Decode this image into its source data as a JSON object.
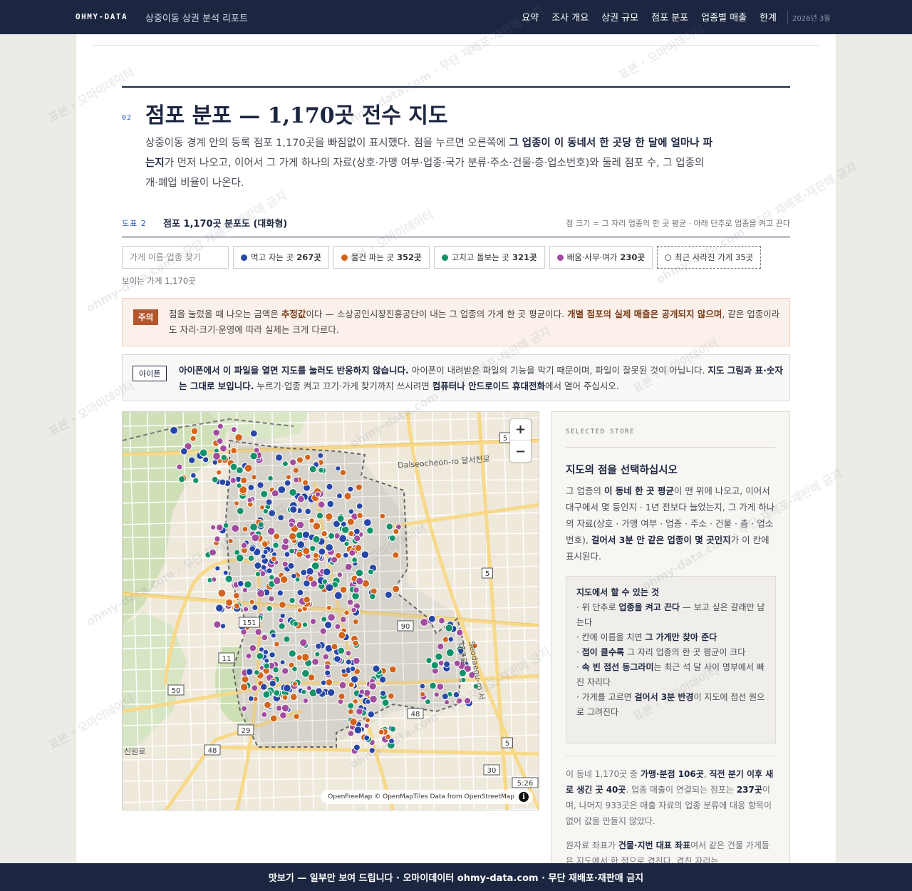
{
  "nav": {
    "brand": "OHMY-DATA",
    "report_title": "상중이동 상권 분석 리포트",
    "links": [
      "요약",
      "조사 개요",
      "상권 규모",
      "점포 분포",
      "업종별 매출",
      "한계"
    ],
    "date": "2026년 3월"
  },
  "section": {
    "number": "02",
    "title": "점포 분포 — 1,170곳 전수 지도",
    "lead_1": "상중이동 경계 안의 등록 점포 1,170곳을 빠짐없이 표시했다. 점을 누르면 오른쪽에 ",
    "lead_b": "그 업종이 이 동네서 한 곳당 한 달에 얼마나 파는지",
    "lead_2": "가 먼저 나오고, 이어서 그 가게 하나의 자료(상호·가맹 여부·업종·국가 분류·주소·건물·층·업소번호)와 둘레 점포 수, 그 업종의 개·폐업 비율이 나온다."
  },
  "figure": {
    "label": "도표 2",
    "title": "점포 1,170곳 분포도 (대화형)",
    "note": "점 크기 = 그 자리 업종의 한 곳 평균 · 아래 단추로 업종을 켜고 끈다"
  },
  "search": {
    "placeholder": "가게 이름·업종 찾기"
  },
  "filters": [
    {
      "label": "먹고 자는 곳",
      "count": "267곳",
      "color": "#2747a8"
    },
    {
      "label": "물건 파는 곳",
      "count": "352곳",
      "color": "#d3641a"
    },
    {
      "label": "고치고 돌보는 곳",
      "count": "321곳",
      "color": "#12926b"
    },
    {
      "label": "배움·사무·여가",
      "count": "230곳",
      "color": "#a24c9f"
    }
  ],
  "closed_filter": {
    "label": "최근 사라진 가게",
    "count": "35곳"
  },
  "visible_count": "보이는 가게 1,170곳",
  "warning": {
    "tag": "주의",
    "t1": "점을 눌렀을 때 나오는 금액은 ",
    "b1": "추정값",
    "t2": "이다 — 소상공인시장진흥공단이 내는 그 업종의 가게 한 곳 평균이다. ",
    "b2": "개별 점포의 실제 매출은 공개되지 않으며",
    "t3": ", 같은 업종이라도 자리·크기·운영에 따라 실제는 크게 다르다."
  },
  "iphone": {
    "tag": "아이폰",
    "b1": "아이폰에서 이 파일을 열면 지도를 눌러도 반응하지 않습니다.",
    "t1": " 아이폰이 내려받은 파일의 기능을 막기 때문이며, 파일이 잘못된 것이 아닙니다. ",
    "b2": "지도 그림과 표·숫자는 그대로 보입니다.",
    "t2": " 누르기·업종 켜고 끄기·가게 찾기까지 쓰시려면 ",
    "b3": "컴퓨터나 안드로이드 휴대전화",
    "t3": "에서 열어 주십시오."
  },
  "map": {
    "attribution": "OpenFreeMap © OpenMapTiles Data from OpenStreetMap",
    "road_labels": [
      "Dalseocheon-ro 달서천로",
      "Seodaegu-ro 서대구로",
      "신원로"
    ],
    "route_shields": [
      "5",
      "151",
      "90",
      "11",
      "50",
      "29",
      "48",
      "30",
      "5",
      "48",
      "5:26",
      "5"
    ],
    "zoom_in": "+",
    "zoom_out": "−"
  },
  "panel": {
    "eyebrow": "SELECTED STORE",
    "title": "지도의 점을 선택하십시오",
    "d1": "그 업종의 ",
    "d_b1": "이 동네 한 곳 평균",
    "d2": "이 맨 위에 나오고, 이어서 대구에서 몇 등인지 · 1년 전보다 늘었는지, 그 가게 하나의 자료(상호 · 가맹 여부 · 업종 · 주소 · 건물 · 층 · 업소번호), ",
    "d_b2": "걸어서 3분 안 같은 업종이 몇 곳인지",
    "d3": "가 이 칸에 표시된다.",
    "box_title": "지도에서 할 수 있는 것",
    "box_items": [
      {
        "pre": "· 위 단추로 ",
        "b": "업종을 켜고 끈다",
        "post": " — 보고 싶은 갈래만 남는다"
      },
      {
        "pre": "· 칸에 이름을 치면 ",
        "b": "그 가게만 찾아 준다",
        "post": ""
      },
      {
        "pre": "· ",
        "b": "점이 클수록",
        "post": " 그 자리 업종의 한 곳 평균이 크다"
      },
      {
        "pre": "· ",
        "b": "속 빈 점선 동그라미",
        "post": "는 최근 석 달 사이 명부에서 빠진 자리다"
      },
      {
        "pre": "· 가게를 고르면 ",
        "b": "걸어서 3분 반경",
        "post": "이 지도에 점선 원으로 그려진다"
      }
    ],
    "s1": "이 동네 1,170곳 중 ",
    "s_b1": "가맹·분점 106곳",
    "s2": ", ",
    "s_b2": "직전 분기 이후 새로 생긴 곳 40곳",
    "s3": ". 업종 매출이 연결되는 점포는 ",
    "s_b3": "237곳",
    "s4": "이며, 나머지 933곳은 매출 자료의 업종 분류에 대응 항목이 없어 값을 만들지 않았다.",
    "s5": "원자료 좌표가 ",
    "s_b4": "건물·지번 대표 좌표",
    "s6": "여서 같은 건물 가게들은 지도에서 한 점으로 겹친다. 겹친 자리는"
  },
  "footer": "맛보기 — 일부만 보여 드립니다 · 오마이데이터 ohmy-data.com · 무단 재배포·재판매 금지",
  "watermark": [
    "표본 · 오마이데이터",
    "ohmy-data.com · 무단 재배포·재판매 금지"
  ],
  "colors": {
    "navy": "#1c2640",
    "accent_blue": "#2f5eb8",
    "warn": "#b4552a"
  }
}
